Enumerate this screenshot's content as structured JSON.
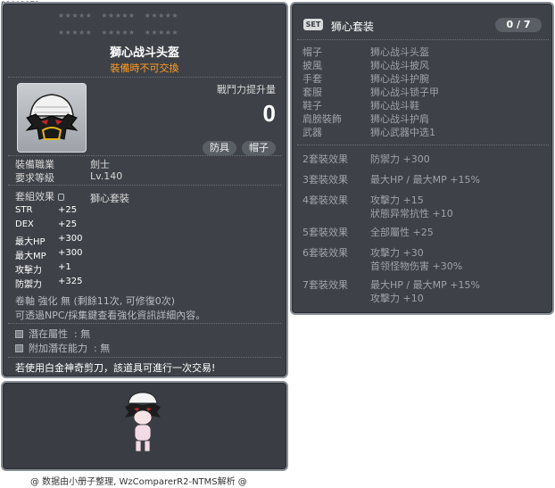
{
  "item_id": "01003172",
  "tooltip": {
    "item_name": "獅心战斗头盔",
    "trade_note": "裝備時不可交換",
    "combat_label": "戰鬥力提升量",
    "combat_value": "0",
    "tags": [
      "防具",
      "帽子"
    ],
    "requirements": [
      {
        "label": "裝備職業",
        "value": "劍士"
      },
      {
        "label": "要求等級",
        "value": "Lv.140"
      }
    ],
    "set_effect_label": "套組效果",
    "set_effect_name": "獅心套裝",
    "stats": [
      {
        "label": "STR",
        "value": "+25"
      },
      {
        "label": "DEX",
        "value": "+25"
      },
      {
        "label": "最大HP",
        "value": "+300"
      },
      {
        "label": "最大MP",
        "value": "+300"
      },
      {
        "label": "攻擊力",
        "value": "+1"
      },
      {
        "label": "防禦力",
        "value": "+325"
      }
    ],
    "upgrade_line": "卷軸 強化 無 (剩餘11次, 可修復0次)",
    "npc_note": "可透過NPC/採集鍵查看強化資訊詳細內容。",
    "potentials": [
      {
        "label": "潛在屬性",
        "value": ": 無"
      },
      {
        "label": "附加潛在能力",
        "value": ": 無"
      }
    ],
    "scissor_note": "若使用白金神奇剪刀，該道具可進行一次交易!"
  },
  "set_panel": {
    "badge": "SET",
    "title": "狮心套装",
    "count": "0 / 7",
    "pieces": [
      {
        "slot": "帽子",
        "name": "狮心战斗头盔"
      },
      {
        "slot": "披風",
        "name": "狮心战斗披风"
      },
      {
        "slot": "手套",
        "name": "狮心战斗护腕"
      },
      {
        "slot": "套服",
        "name": "狮心战斗锁子甲"
      },
      {
        "slot": "鞋子",
        "name": "狮心战斗鞋"
      },
      {
        "slot": "肩膀裝飾",
        "name": "狮心战斗护肩"
      },
      {
        "slot": "武器",
        "name": "狮心武器中选1"
      }
    ],
    "effects": [
      {
        "tier": "2套裝效果",
        "lines": [
          "防禦力  +300"
        ]
      },
      {
        "tier": "3套裝效果",
        "lines": [
          "最大HP / 最大MP  +15%"
        ]
      },
      {
        "tier": "4套裝效果",
        "lines": [
          "攻擊力  +15",
          "狀態异常抗性  +10"
        ]
      },
      {
        "tier": "5套裝效果",
        "lines": [
          "全部屬性  +25"
        ]
      },
      {
        "tier": "6套裝效果",
        "lines": [
          "攻擊力  +30",
          "首领怪物伤害  +30%"
        ]
      },
      {
        "tier": "7套裝效果",
        "lines": [
          "最大HP / 最大MP  +15%",
          "攻擊力  +10"
        ]
      }
    ]
  },
  "footer": "@ 数据由小册子整理, WzComparerR2-NTMS解析 @",
  "icons": {
    "item_icon": "helmet-icon",
    "lock": "lock-icon",
    "potential": "potential-icon",
    "preview": "character-preview"
  },
  "colors": {
    "panel_bg": "#3e4248",
    "panel_border": "#8a9099",
    "trade_note": "#ff9c20",
    "dim_text": "#9ea3a9"
  }
}
